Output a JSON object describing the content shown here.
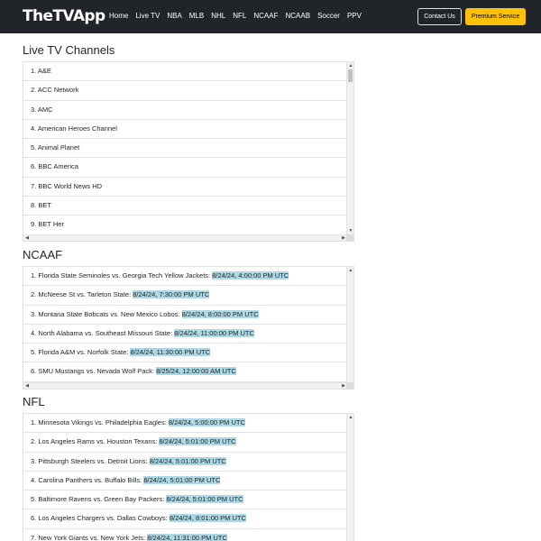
{
  "navbar": {
    "brand": "TheTVApp",
    "links": [
      "Home",
      "Live TV",
      "NBA",
      "MLB",
      "NHL",
      "NFL",
      "NCAAF",
      "NCAAB",
      "Soccer",
      "PPV"
    ],
    "contact_label": "Contact Us",
    "premium_label": "Premium Service"
  },
  "live_tv": {
    "title": "Live TV Channels",
    "items": [
      "1. A&E",
      "2. ACC Network",
      "3. AMC",
      "4. American Heroes Channel",
      "5. Animal Planet",
      "6. BBC America",
      "7. BBC World News HD",
      "8. BET",
      "9. BET Her"
    ]
  },
  "ncaaf": {
    "title": "NCAAF",
    "items": [
      {
        "match": "1. Florida State Seminoles vs. Georgia Tech Yellow Jackets: ",
        "time": "8/24/24, 4:00:00 PM UTC"
      },
      {
        "match": "2. McNeese St vs. Tarleton State: ",
        "time": "8/24/24, 7:30:00 PM UTC"
      },
      {
        "match": "3. Montana State Bobcats vs. New Mexico Lobos: ",
        "time": "8/24/24, 8:00:00 PM UTC"
      },
      {
        "match": "4. North Alabama vs. Southeast Missouri State: ",
        "time": "8/24/24, 11:00:00 PM UTC"
      },
      {
        "match": "5. Florida A&M vs. Norfolk State: ",
        "time": "8/24/24, 11:30:00 PM UTC"
      },
      {
        "match": "6. SMU Mustangs vs. Nevada Wolf Pack: ",
        "time": "8/25/24, 12:00:00 AM UTC"
      }
    ]
  },
  "nfl": {
    "title": "NFL",
    "items": [
      {
        "match": "1. Minnesota Vikings vs. Philadelphia Eagles: ",
        "time": "8/24/24, 5:00:00 PM UTC"
      },
      {
        "match": "2. Los Angeles Rams vs. Houston Texans: ",
        "time": "8/24/24, 5:01:00 PM UTC"
      },
      {
        "match": "3. Pittsburgh Steelers vs. Detroit Lions: ",
        "time": "8/24/24, 5:01:00 PM UTC"
      },
      {
        "match": "4. Carolina Panthers vs. Buffalo Bills: ",
        "time": "8/24/24, 5:01:00 PM UTC"
      },
      {
        "match": "5. Baltimore Ravens vs. Green Bay Packers: ",
        "time": "8/24/24, 5:01:00 PM UTC"
      },
      {
        "match": "6. Los Angeles Chargers vs. Dallas Cowboys: ",
        "time": "8/24/24, 8:01:00 PM UTC"
      },
      {
        "match": "7. New York Giants vs. New York Jets: ",
        "time": "8/24/24, 11:31:00 PM UTC"
      }
    ]
  },
  "colors": {
    "navbar_bg": "#212529",
    "premium_bg": "#ffc107",
    "time_highlight": "#add8e6"
  }
}
